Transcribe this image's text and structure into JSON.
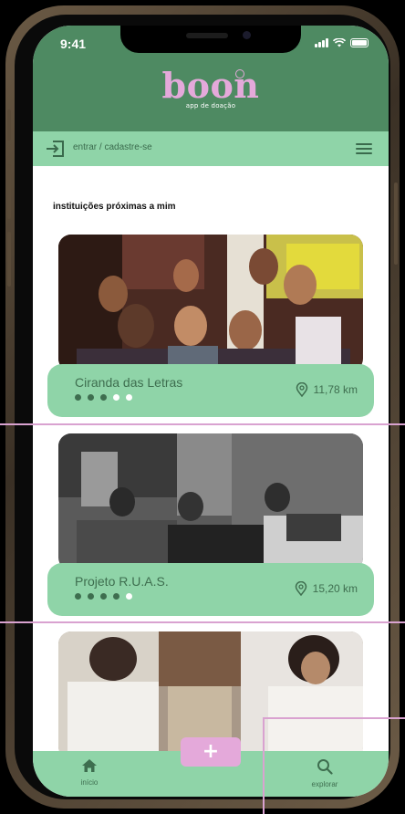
{
  "status": {
    "time": "9:41"
  },
  "app": {
    "name": "boon",
    "tagline": "app de doação"
  },
  "nav": {
    "login_label": "entrar / cadastre-se"
  },
  "section": {
    "title": "instituições próximas a mim"
  },
  "cards": [
    {
      "name": "Ciranda das Letras",
      "distance": "11,78 km",
      "rating": 3,
      "max_rating": 5
    },
    {
      "name": "Projeto R.U.A.S.",
      "distance": "15,20 km",
      "rating": 4,
      "max_rating": 5
    }
  ],
  "tabbar": {
    "home_label": "início",
    "explore_label": "explorar",
    "add_label": "+"
  },
  "colors": {
    "header": "#4e8a62",
    "accent_green": "#8fd4a8",
    "accent_pink": "#e4a9da",
    "text_green": "#3e6e4f"
  }
}
